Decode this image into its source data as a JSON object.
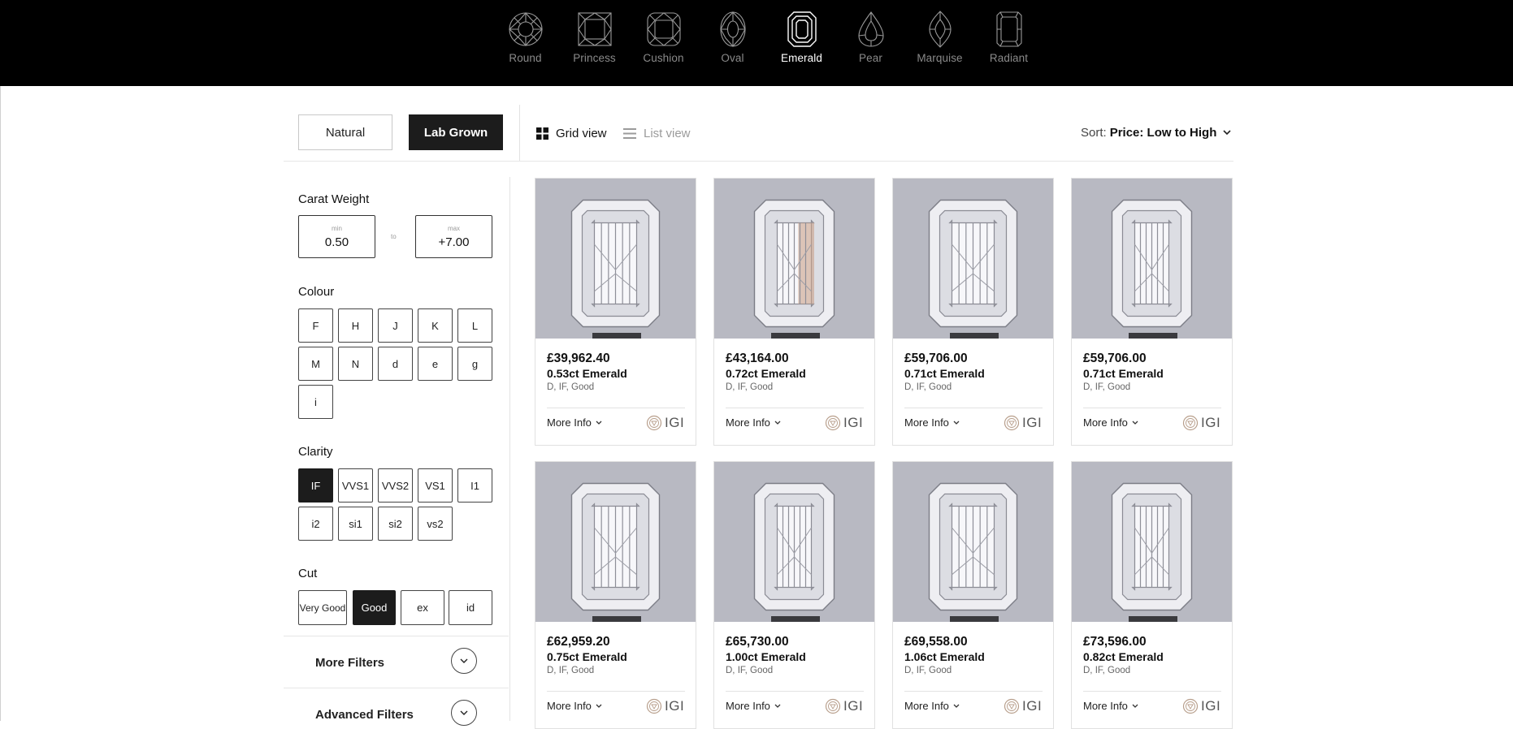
{
  "shapes": [
    {
      "label": "Round",
      "icon": "round-diamond-icon",
      "active": false
    },
    {
      "label": "Princess",
      "icon": "princess-diamond-icon",
      "active": false
    },
    {
      "label": "Cushion",
      "icon": "cushion-diamond-icon",
      "active": false
    },
    {
      "label": "Oval",
      "icon": "oval-diamond-icon",
      "active": false
    },
    {
      "label": "Emerald",
      "icon": "emerald-diamond-icon",
      "active": true
    },
    {
      "label": "Pear",
      "icon": "pear-diamond-icon",
      "active": false
    },
    {
      "label": "Marquise",
      "icon": "marquise-diamond-icon",
      "active": false
    },
    {
      "label": "Radiant",
      "icon": "radiant-diamond-icon",
      "active": false
    }
  ],
  "toolbar": {
    "natural_label": "Natural",
    "lab_grown_label": "Lab Grown",
    "selected_type": "Lab Grown",
    "grid_view_label": "Grid view",
    "list_view_label": "List view",
    "active_view": "Grid view",
    "sort_prefix": "Sort:",
    "sort_value": "Price: Low to High"
  },
  "filters": {
    "carat": {
      "title": "Carat Weight",
      "min_caption": "min",
      "min_value": "0.50",
      "to_label": "to",
      "max_caption": "max",
      "max_value": "+7.00"
    },
    "colour": {
      "title": "Colour",
      "options": [
        "F",
        "H",
        "J",
        "K",
        "L",
        "M",
        "N",
        "d",
        "e",
        "g",
        "i"
      ],
      "selected": []
    },
    "clarity": {
      "title": "Clarity",
      "options": [
        "IF",
        "VVS1",
        "VVS2",
        "VS1",
        "I1",
        "i2",
        "si1",
        "si2",
        "vs2"
      ],
      "selected": [
        "IF"
      ]
    },
    "cut": {
      "title": "Cut",
      "options": [
        "Very Good",
        "Good",
        "ex",
        "id"
      ],
      "selected": [
        "Good"
      ]
    },
    "more_filters_label": "More Filters",
    "advanced_filters_label": "Advanced Filters"
  },
  "products": [
    {
      "price": "£39,962.40",
      "name": "0.53ct Emerald",
      "spec": "D, IF, Good",
      "more": "More Info",
      "cert": "IGI"
    },
    {
      "price": "£43,164.00",
      "name": "0.72ct Emerald",
      "spec": "D, IF, Good",
      "more": "More Info",
      "cert": "IGI"
    },
    {
      "price": "£59,706.00",
      "name": "0.71ct Emerald",
      "spec": "D, IF, Good",
      "more": "More Info",
      "cert": "IGI"
    },
    {
      "price": "£59,706.00",
      "name": "0.71ct Emerald",
      "spec": "D, IF, Good",
      "more": "More Info",
      "cert": "IGI"
    },
    {
      "price": "£62,959.20",
      "name": "0.75ct Emerald",
      "spec": "D, IF, Good",
      "more": "More Info",
      "cert": "IGI"
    },
    {
      "price": "£65,730.00",
      "name": "1.00ct Emerald",
      "spec": "D, IF, Good",
      "more": "More Info",
      "cert": "IGI"
    },
    {
      "price": "£69,558.00",
      "name": "1.06ct Emerald",
      "spec": "D, IF, Good",
      "more": "More Info",
      "cert": "IGI"
    },
    {
      "price": "£73,596.00",
      "name": "0.82ct Emerald",
      "spec": "D, IF, Good",
      "more": "More Info",
      "cert": "IGI"
    }
  ],
  "colors": {
    "header_bg": "#000000",
    "accent_dark": "#1c1c1c",
    "photo_bg": "#b8b9c2",
    "muted_text": "#8a8a8a"
  }
}
